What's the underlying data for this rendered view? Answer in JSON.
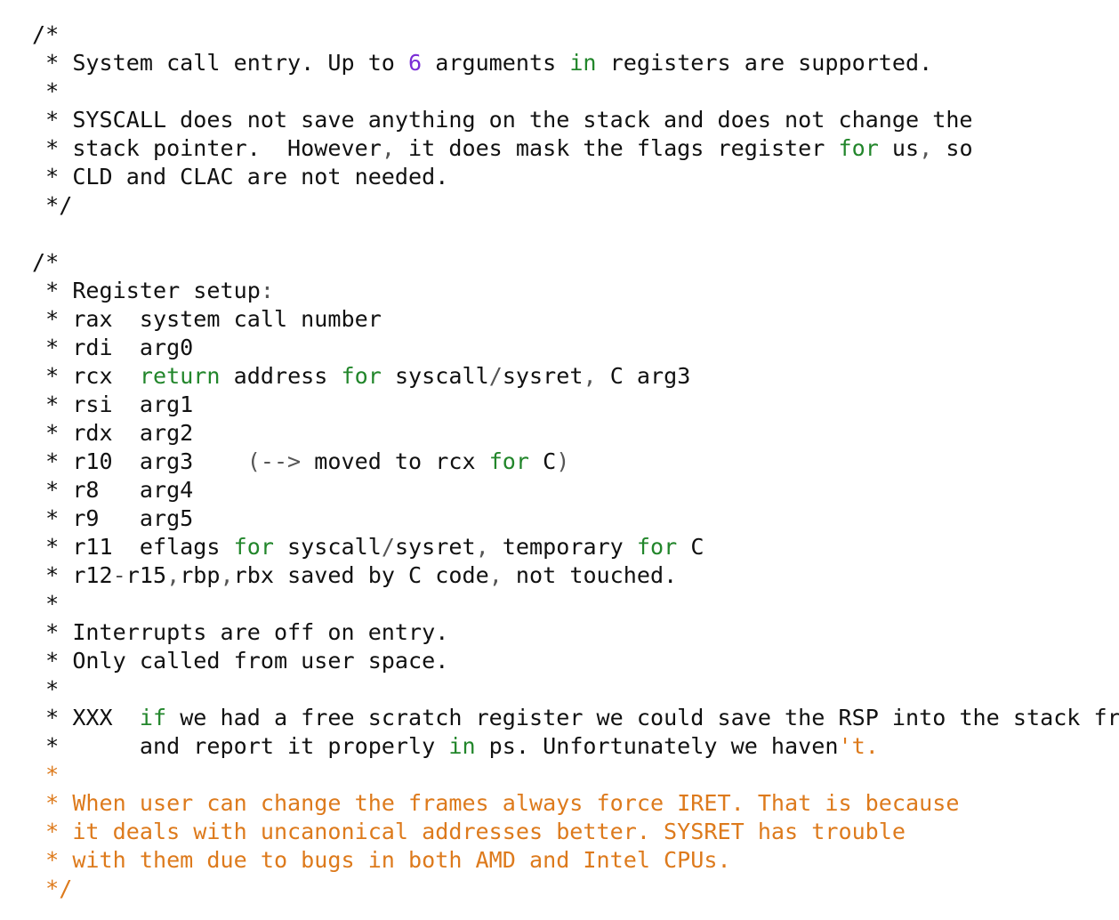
{
  "colors": {
    "text": "#111111",
    "number": "#7a2cd6",
    "keyword": "#22862b",
    "punctuation": "#555555",
    "string": "#dd7a1c",
    "background": "#ffffff"
  },
  "lines": [
    [
      {
        "t": "/*",
        "k": "plain"
      }
    ],
    [
      {
        "t": " * System call entry. Up to ",
        "k": "plain"
      },
      {
        "t": "6",
        "k": "num"
      },
      {
        "t": " arguments ",
        "k": "plain"
      },
      {
        "t": "in",
        "k": "kw"
      },
      {
        "t": " registers are supported.",
        "k": "plain"
      }
    ],
    [
      {
        "t": " *",
        "k": "plain"
      }
    ],
    [
      {
        "t": " * SYSCALL does not save anything on the stack and does not change the",
        "k": "plain"
      }
    ],
    [
      {
        "t": " * stack pointer.  However",
        "k": "plain"
      },
      {
        "t": ",",
        "k": "punct"
      },
      {
        "t": " it does mask the flags register ",
        "k": "plain"
      },
      {
        "t": "for",
        "k": "kw"
      },
      {
        "t": " us",
        "k": "plain"
      },
      {
        "t": ",",
        "k": "punct"
      },
      {
        "t": " so",
        "k": "plain"
      }
    ],
    [
      {
        "t": " * CLD and CLAC are not needed.",
        "k": "plain"
      }
    ],
    [
      {
        "t": " */",
        "k": "plain"
      }
    ],
    [
      {
        "t": "",
        "k": "plain"
      }
    ],
    [
      {
        "t": "/*",
        "k": "plain"
      }
    ],
    [
      {
        "t": " * Register setup",
        "k": "plain"
      },
      {
        "t": ":",
        "k": "punct"
      }
    ],
    [
      {
        "t": " * rax  system call number",
        "k": "plain"
      }
    ],
    [
      {
        "t": " * rdi  arg0",
        "k": "plain"
      }
    ],
    [
      {
        "t": " * rcx  ",
        "k": "plain"
      },
      {
        "t": "return",
        "k": "kw"
      },
      {
        "t": " address ",
        "k": "plain"
      },
      {
        "t": "for",
        "k": "kw"
      },
      {
        "t": " syscall",
        "k": "plain"
      },
      {
        "t": "/",
        "k": "punct"
      },
      {
        "t": "sysret",
        "k": "plain"
      },
      {
        "t": ",",
        "k": "punct"
      },
      {
        "t": " C arg3",
        "k": "plain"
      }
    ],
    [
      {
        "t": " * rsi  arg1",
        "k": "plain"
      }
    ],
    [
      {
        "t": " * rdx  arg2",
        "k": "plain"
      }
    ],
    [
      {
        "t": " * r10  arg3    ",
        "k": "plain"
      },
      {
        "t": "(-->",
        "k": "punct"
      },
      {
        "t": " moved to rcx ",
        "k": "plain"
      },
      {
        "t": "for",
        "k": "kw"
      },
      {
        "t": " C",
        "k": "plain"
      },
      {
        "t": ")",
        "k": "punct"
      }
    ],
    [
      {
        "t": " * r8   arg4",
        "k": "plain"
      }
    ],
    [
      {
        "t": " * r9   arg5",
        "k": "plain"
      }
    ],
    [
      {
        "t": " * r11  eflags ",
        "k": "plain"
      },
      {
        "t": "for",
        "k": "kw"
      },
      {
        "t": " syscall",
        "k": "plain"
      },
      {
        "t": "/",
        "k": "punct"
      },
      {
        "t": "sysret",
        "k": "plain"
      },
      {
        "t": ",",
        "k": "punct"
      },
      {
        "t": " temporary ",
        "k": "plain"
      },
      {
        "t": "for",
        "k": "kw"
      },
      {
        "t": " C",
        "k": "plain"
      }
    ],
    [
      {
        "t": " * r12",
        "k": "plain"
      },
      {
        "t": "-",
        "k": "punct"
      },
      {
        "t": "r15",
        "k": "plain"
      },
      {
        "t": ",",
        "k": "punct"
      },
      {
        "t": "rbp",
        "k": "plain"
      },
      {
        "t": ",",
        "k": "punct"
      },
      {
        "t": "rbx saved by C code",
        "k": "plain"
      },
      {
        "t": ",",
        "k": "punct"
      },
      {
        "t": " not touched.",
        "k": "plain"
      }
    ],
    [
      {
        "t": " *",
        "k": "plain"
      }
    ],
    [
      {
        "t": " * Interrupts are off on entry.",
        "k": "plain"
      }
    ],
    [
      {
        "t": " * Only called from user space.",
        "k": "plain"
      }
    ],
    [
      {
        "t": " *",
        "k": "plain"
      }
    ],
    [
      {
        "t": " * XXX  ",
        "k": "plain"
      },
      {
        "t": "if",
        "k": "kw"
      },
      {
        "t": " we had a free scratch register we could save the RSP into the stack frame",
        "k": "plain"
      }
    ],
    [
      {
        "t": " *      and report it properly ",
        "k": "plain"
      },
      {
        "t": "in",
        "k": "kw"
      },
      {
        "t": " ps. Unfortunately we haven",
        "k": "plain"
      },
      {
        "t": "'t.",
        "k": "str"
      }
    ],
    [
      {
        "t": " *",
        "k": "str"
      }
    ],
    [
      {
        "t": " * When user can change the frames always force IRET. That is because",
        "k": "str"
      }
    ],
    [
      {
        "t": " * it deals with uncanonical addresses better. SYSRET has trouble",
        "k": "str"
      }
    ],
    [
      {
        "t": " * with them due to bugs in both AMD and Intel CPUs.",
        "k": "str"
      }
    ],
    [
      {
        "t": " */",
        "k": "str"
      }
    ]
  ]
}
